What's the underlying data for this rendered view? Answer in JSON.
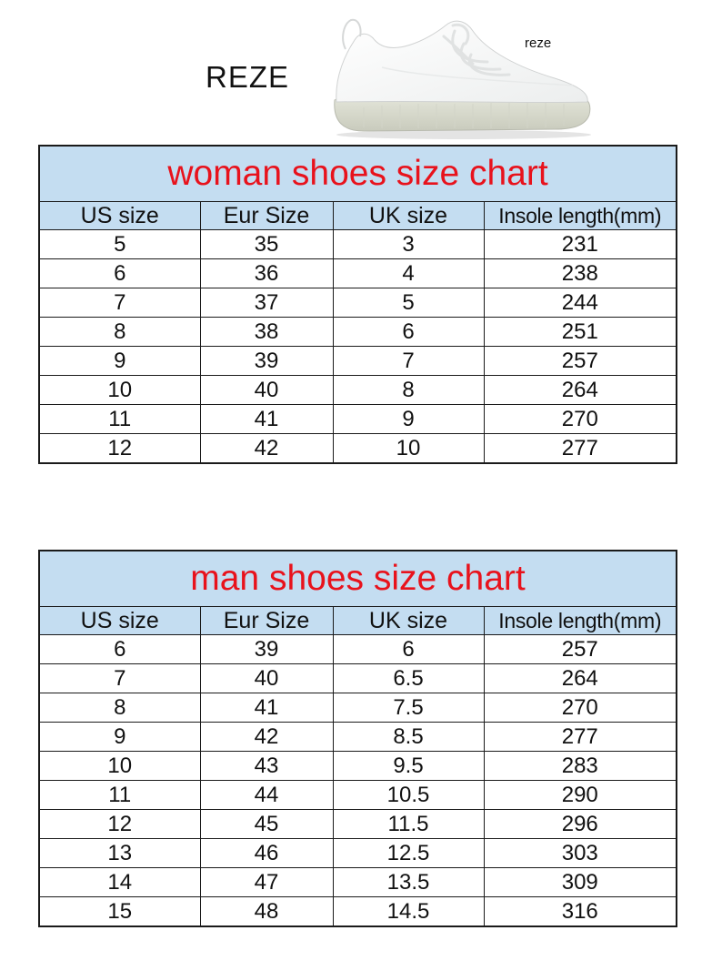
{
  "brand": "REZE",
  "shoe_tag": "reze",
  "woman": {
    "title": "woman shoes size chart",
    "headers": [
      "US size",
      "Eur Size",
      "UK size",
      "Insole length(mm)"
    ],
    "rows": [
      [
        "5",
        "35",
        "3",
        "231"
      ],
      [
        "6",
        "36",
        "4",
        "238"
      ],
      [
        "7",
        "37",
        "5",
        "244"
      ],
      [
        "8",
        "38",
        "6",
        "251"
      ],
      [
        "9",
        "39",
        "7",
        "257"
      ],
      [
        "10",
        "40",
        "8",
        "264"
      ],
      [
        "11",
        "41",
        "9",
        "270"
      ],
      [
        "12",
        "42",
        "10",
        "277"
      ]
    ]
  },
  "man": {
    "title": "man shoes size chart",
    "headers": [
      "US size",
      "Eur Size",
      "UK size",
      "Insole length(mm)"
    ],
    "rows": [
      [
        "6",
        "39",
        "6",
        "257"
      ],
      [
        "7",
        "40",
        "6.5",
        "264"
      ],
      [
        "8",
        "41",
        "7.5",
        "270"
      ],
      [
        "9",
        "42",
        "8.5",
        "277"
      ],
      [
        "10",
        "43",
        "9.5",
        "283"
      ],
      [
        "11",
        "44",
        "10.5",
        "290"
      ],
      [
        "12",
        "45",
        "11.5",
        "296"
      ],
      [
        "13",
        "46",
        "12.5",
        "303"
      ],
      [
        "14",
        "47",
        "13.5",
        "309"
      ],
      [
        "15",
        "48",
        "14.5",
        "316"
      ]
    ]
  },
  "colors": {
    "title_red": "#e8121c",
    "header_blue": "#c4ddf1",
    "border": "#1a1a1a"
  },
  "icons": {
    "product_image": "white-knit-sneaker"
  }
}
